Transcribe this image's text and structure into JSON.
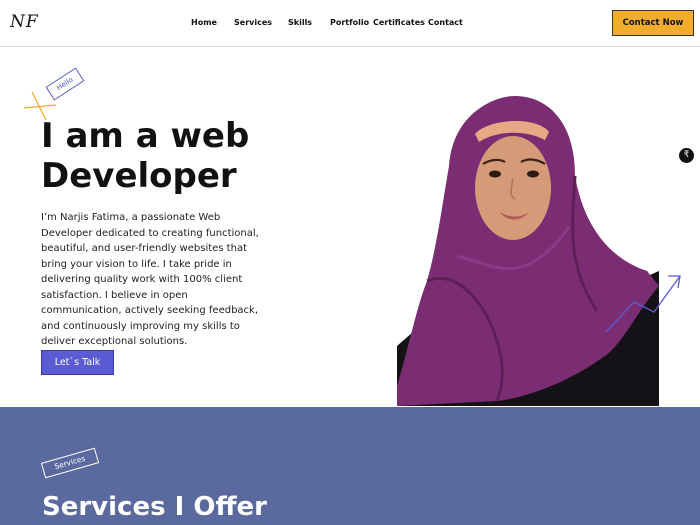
{
  "nav": {
    "logo": "NF",
    "items": [
      "Home",
      "Services",
      "Skills",
      "Portfolio",
      "Certificates",
      "Contact"
    ],
    "cta": "Contact Now"
  },
  "hero": {
    "tag": "Hello",
    "title_line1": "I am a web",
    "title_line2": "Developer",
    "paragraph": "I’m Narjis Fatima, a passionate Web Developer dedicated to creating functional, beautiful, and user-friendly websites that bring your vision to life. I take pride in delivering quality work with 100% client satisfaction. I believe in open communication, actively seeking feedback, and continuously improving my skills to deliver exceptional solutions.",
    "button": "Let`s Talk",
    "side_icon": "₹"
  },
  "services": {
    "tag": "Services",
    "title": "Services I Offer"
  },
  "colors": {
    "accent_purple": "#5b5bd3",
    "cta_orange": "#f2ac2b",
    "services_bg": "#5a6a9e",
    "hijab_purple": "#7b2d73"
  }
}
